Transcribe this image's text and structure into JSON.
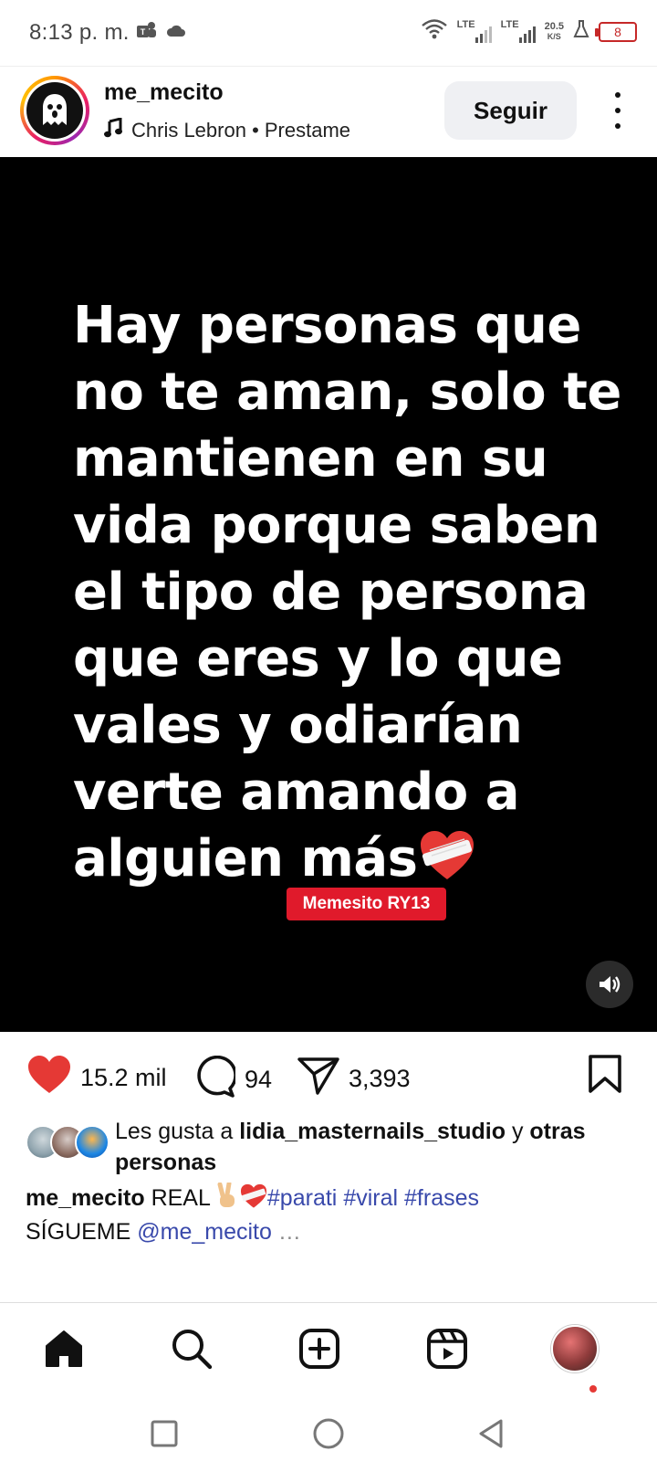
{
  "status_bar": {
    "time": "8:13 p. m.",
    "network_1": "LTE",
    "network_2": "LTE",
    "speed_value": "20.5",
    "speed_unit": "K/S",
    "battery": "8",
    "icons": [
      "teams-icon",
      "cloud-icon",
      "wifi-icon",
      "signal-icon",
      "signal-icon",
      "flask-icon",
      "battery-icon"
    ]
  },
  "post": {
    "username": "me_mecito",
    "music_artist_track": "Chris Lebron • Prestame",
    "follow_label": "Seguir",
    "quote_lines": [
      "Hay personas que",
      "no te aman, solo te",
      "mantienen en su",
      "vida porque saben",
      "el tipo de persona",
      "que eres y lo que",
      "vales y odiarían",
      "verte amando a",
      "alguien más"
    ],
    "watermark": "Memesito RY13",
    "likes_count": "15.2 mil",
    "comments_count": "94",
    "shares_count": "3,393",
    "liked_by_prefix": "Les gusta a ",
    "liked_by_user": "lidia_masternails_studio",
    "liked_by_mid": " y ",
    "liked_by_others": "otras personas",
    "caption_user": "me_mecito",
    "caption_text": " REAL ",
    "hashtags": [
      "#parati",
      "#viral",
      "#frases"
    ],
    "caption_line2": "SÍGUEME ",
    "caption_mention": "@me_mecito",
    "caption_more": " …"
  },
  "colors": {
    "like_red": "#e53935",
    "hashtag_blue": "#3949ab",
    "watermark_red": "#e01a2b",
    "media_bg": "#000000"
  },
  "bottom_nav": [
    "home-icon",
    "search-icon",
    "create-icon",
    "reels-icon",
    "profile-avatar"
  ],
  "system_nav": [
    "recents-button",
    "home-button",
    "back-button"
  ]
}
